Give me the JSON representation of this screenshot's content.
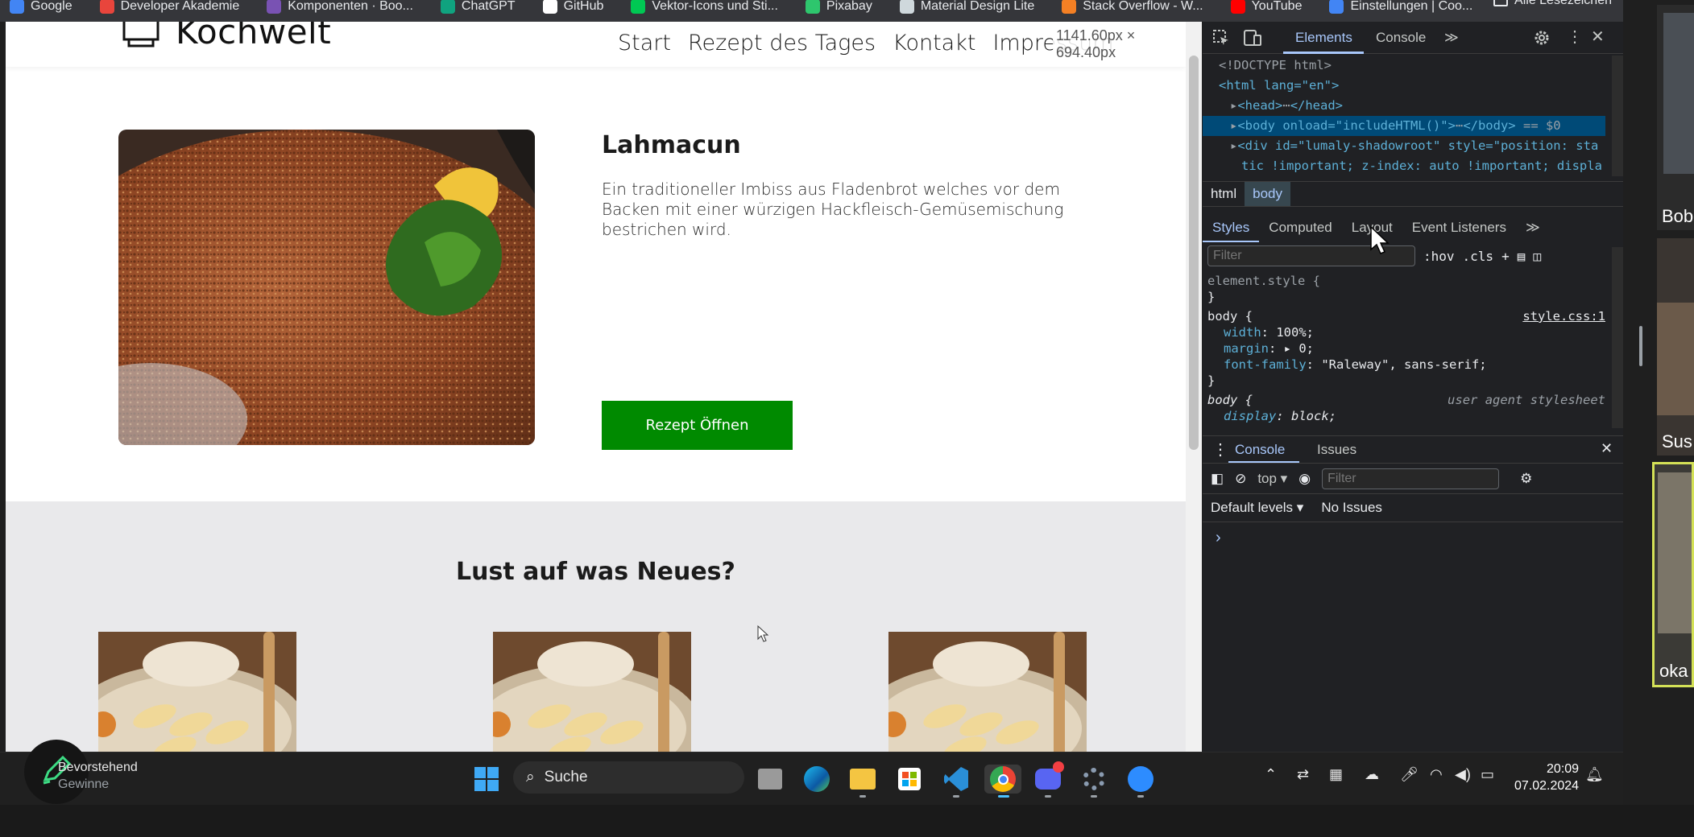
{
  "bookmarks": {
    "items": [
      {
        "label": "Google",
        "color": "#4285f4"
      },
      {
        "label": "Developer Akademie",
        "color": "#e8453c"
      },
      {
        "label": "Komponenten · Boo...",
        "color": "#7952b3"
      },
      {
        "label": "ChatGPT",
        "color": "#10a37f"
      },
      {
        "label": "GitHub",
        "color": "#ffffff"
      },
      {
        "label": "Vektor-Icons und Sti...",
        "color": "#00c853"
      },
      {
        "label": "Pixabay",
        "color": "#2ec66d"
      },
      {
        "label": "Material Design Lite",
        "color": "#cfd8dc"
      },
      {
        "label": "Stack Overflow - W...",
        "color": "#f48024"
      },
      {
        "label": "YouTube",
        "color": "#ff0000"
      },
      {
        "label": "Einstellungen | Coo...",
        "color": "#4285f4"
      }
    ],
    "all_label": "Alle Lesezeichen"
  },
  "site": {
    "logo_text": "Kochwelt",
    "nav": [
      "Start",
      "Rezept des Tages",
      "Kontakt",
      "Impressum"
    ],
    "dimension_badge": "1141.60px × 694.40px",
    "hero": {
      "title": "Lahmacun",
      "description": "Ein traditioneller Imbiss aus Fladenbrot welches vor dem Backen mit einer würzigen Hackfleisch-Gemüsemischung bestrichen wird.",
      "button_label": "Rezept Öffnen",
      "button_color": "#008a00"
    },
    "section_title": "Lust auf was Neues?"
  },
  "devtools": {
    "tabs": [
      "Elements",
      "Console"
    ],
    "code": {
      "doctype": "<!DOCTYPE html>",
      "html_open": "<html lang=\"en\">",
      "head": "<head>",
      "head_close": "</head>",
      "body_tag": "<body onload=\"includeHTML()\">",
      "body_close": "</body>",
      "body_suffix": "== $0",
      "div_line1": "<div id=\"lumaly-shadowroot\" style=\"position: sta",
      "div_line2": "tic !important; z-index: auto !important; displa"
    },
    "breadcrumbs": [
      "html",
      "body"
    ],
    "subtabs": [
      "Styles",
      "Computed",
      "Layout",
      "Event Listeners"
    ],
    "filter_placeholder": "Filter",
    "hov_label": ":hov",
    "cls_label": ".cls",
    "styles": {
      "element_style": "element.style {",
      "rule_selector": "body {",
      "rule_source": "style.css:1",
      "props": [
        {
          "name": "width",
          "value": "100%;"
        },
        {
          "name": "margin",
          "value": "▸ 0;"
        },
        {
          "name": "font-family",
          "value": "\"Raleway\", sans-serif;"
        }
      ],
      "ua_selector": "body {",
      "ua_source": "user agent stylesheet",
      "ua_prop_name": "display",
      "ua_prop_value": "block;"
    },
    "console": {
      "tabs": [
        "Console",
        "Issues"
      ],
      "context": "top",
      "filter_placeholder": "Filter",
      "levels": "Default levels",
      "issues": "No Issues",
      "prompt": "›"
    }
  },
  "participants": [
    "Bob",
    "Sus",
    "oka"
  ],
  "taskbar": {
    "widget_line1": "Bevorstehend",
    "widget_line2": "Gewinne",
    "search_label": "Suche",
    "time": "20:09",
    "date": "07.02.2024"
  }
}
